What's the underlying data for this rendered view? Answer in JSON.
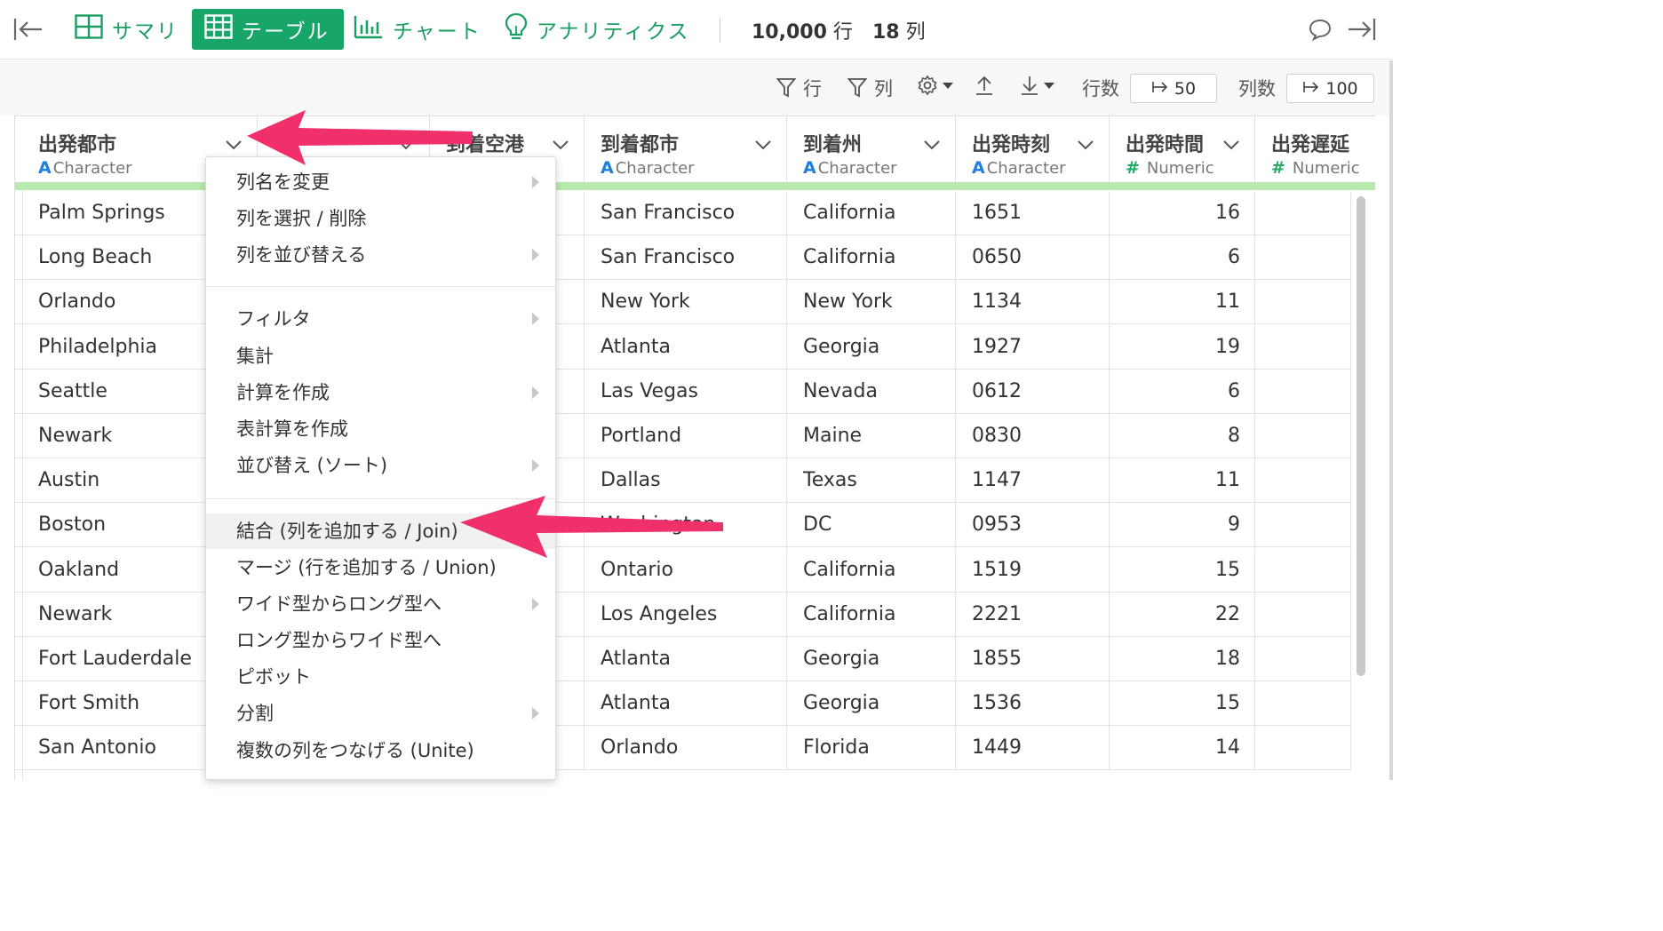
{
  "toolbar": {
    "summary_label": "サマリ",
    "table_label": "テーブル",
    "chart_label": "チャート",
    "analytics_label": "アナリティクス",
    "row_count": "10,000",
    "row_unit": "行",
    "col_count": "18",
    "col_unit": "列"
  },
  "toolbar2": {
    "filter_rows_label": "行",
    "filter_cols_label": "列",
    "rows_label": "行数",
    "rows_value": "50",
    "cols_label": "列数",
    "cols_value": "100"
  },
  "columns": [
    {
      "name": "出発都市",
      "type": "Character",
      "type_icon": "A"
    },
    {
      "name": "",
      "type": "",
      "type_icon": ""
    },
    {
      "name": "到着空港",
      "type": "",
      "type_icon": ""
    },
    {
      "name": "到着都市",
      "type": "Character",
      "type_icon": "A"
    },
    {
      "name": "到着州",
      "type": "Character",
      "type_icon": "A"
    },
    {
      "name": "出発時刻",
      "type": "Character",
      "type_icon": "A"
    },
    {
      "name": "出発時間",
      "type": "Numeric",
      "type_icon": "#"
    },
    {
      "name": "出発遅延",
      "type": "Numeric",
      "type_icon": "#"
    }
  ],
  "rows": [
    [
      "Palm Springs",
      "San Francisco",
      "California",
      "1651",
      "16"
    ],
    [
      "Long Beach",
      "San Francisco",
      "California",
      "0650",
      "6"
    ],
    [
      "Orlando",
      "New York",
      "New York",
      "1134",
      "11"
    ],
    [
      "Philadelphia",
      "Atlanta",
      "Georgia",
      "1927",
      "19"
    ],
    [
      "Seattle",
      "Las Vegas",
      "Nevada",
      "0612",
      "6"
    ],
    [
      "Newark",
      "Portland",
      "Maine",
      "0830",
      "8"
    ],
    [
      "Austin",
      "Dallas",
      "Texas",
      "1147",
      "11"
    ],
    [
      "Boston",
      "Washington",
      "DC",
      "0953",
      "9"
    ],
    [
      "Oakland",
      "Ontario",
      "California",
      "1519",
      "15"
    ],
    [
      "Newark",
      "Los Angeles",
      "California",
      "2221",
      "22"
    ],
    [
      "Fort Lauderdale",
      "Atlanta",
      "Georgia",
      "1855",
      "18"
    ],
    [
      "Fort Smith",
      "Atlanta",
      "Georgia",
      "1536",
      "15"
    ],
    [
      "San Antonio",
      "Orlando",
      "Florida",
      "1449",
      "14"
    ]
  ],
  "menu": {
    "items": [
      {
        "label": "列名を変更",
        "submenu": true
      },
      {
        "label": "列を選択 / 削除",
        "submenu": false
      },
      {
        "label": "列を並び替える",
        "submenu": true
      },
      {
        "label": "フィルタ",
        "submenu": true
      },
      {
        "label": "集計",
        "submenu": false
      },
      {
        "label": "計算を作成",
        "submenu": true
      },
      {
        "label": "表計算を作成",
        "submenu": false
      },
      {
        "label": "並び替え (ソート)",
        "submenu": true
      },
      {
        "label": "結合 (列を追加する / Join)",
        "submenu": false
      },
      {
        "label": "マージ (行を追加する / Union)",
        "submenu": false
      },
      {
        "label": "ワイド型からロング型へ",
        "submenu": true
      },
      {
        "label": "ロング型からワイド型へ",
        "submenu": false
      },
      {
        "label": "ピボット",
        "submenu": false
      },
      {
        "label": "分割",
        "submenu": true
      },
      {
        "label": "複数の列をつなげる (Unite)",
        "submenu": false
      }
    ]
  },
  "colors": {
    "accent_green": "#17a56a",
    "char_type": "#1f7fe0",
    "num_type": "#22aa66",
    "data_bar": "#b8eab0",
    "annotation_arrow": "#f0306a"
  },
  "icons": {
    "back": "collapse-left-icon",
    "summary": "grid-icon",
    "table": "table-icon",
    "chart": "bar-chart-icon",
    "analytics": "lightbulb-icon",
    "comment": "speech-bubble-icon",
    "collapse_right": "collapse-right-icon",
    "filter": "filter-icon",
    "settings": "gear-icon",
    "upload": "upload-icon",
    "download": "download-icon",
    "chevron": "chevron-down-icon"
  }
}
